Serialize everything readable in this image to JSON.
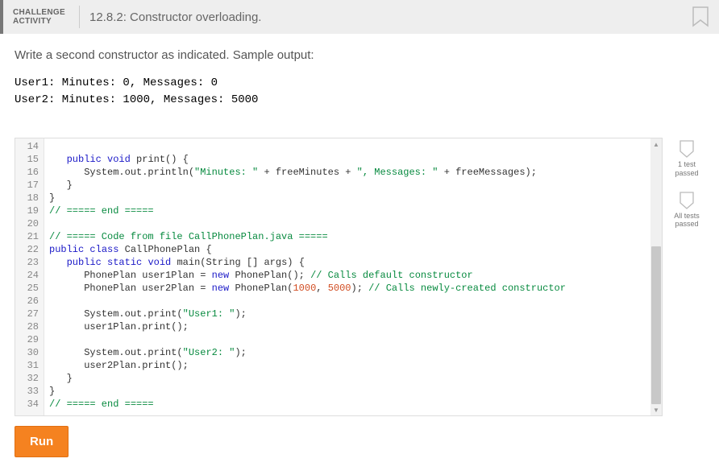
{
  "header": {
    "label_line1": "CHALLENGE",
    "label_line2": "ACTIVITY",
    "title": "12.8.2: Constructor overloading."
  },
  "instructions": "Write a second constructor as indicated. Sample output:",
  "sample_output": "User1: Minutes: 0, Messages: 0\nUser2: Minutes: 1000, Messages: 5000",
  "editor": {
    "first_line_no": 14,
    "lines": [
      {
        "n": 14,
        "tokens": []
      },
      {
        "n": 15,
        "tokens": [
          [
            "pl",
            "   "
          ],
          [
            "kw",
            "public"
          ],
          [
            "pl",
            " "
          ],
          [
            "kw",
            "void"
          ],
          [
            "pl",
            " print() {"
          ]
        ]
      },
      {
        "n": 16,
        "tokens": [
          [
            "pl",
            "      System.out.println("
          ],
          [
            "str",
            "\"Minutes: \""
          ],
          [
            "pl",
            " + freeMinutes + "
          ],
          [
            "str",
            "\", Messages: \""
          ],
          [
            "pl",
            " + freeMessages);"
          ]
        ]
      },
      {
        "n": 17,
        "tokens": [
          [
            "pl",
            "   }"
          ]
        ]
      },
      {
        "n": 18,
        "tokens": [
          [
            "pl",
            "}"
          ]
        ]
      },
      {
        "n": 19,
        "tokens": [
          [
            "cm",
            "// ===== end ====="
          ]
        ]
      },
      {
        "n": 20,
        "tokens": []
      },
      {
        "n": 21,
        "tokens": [
          [
            "cm",
            "// ===== Code from file CallPhonePlan.java ====="
          ]
        ]
      },
      {
        "n": 22,
        "tokens": [
          [
            "kw",
            "public"
          ],
          [
            "pl",
            " "
          ],
          [
            "kw",
            "class"
          ],
          [
            "pl",
            " CallPhonePlan {"
          ]
        ]
      },
      {
        "n": 23,
        "tokens": [
          [
            "pl",
            "   "
          ],
          [
            "kw",
            "public"
          ],
          [
            "pl",
            " "
          ],
          [
            "kw",
            "static"
          ],
          [
            "pl",
            " "
          ],
          [
            "kw",
            "void"
          ],
          [
            "pl",
            " main(String [] args) {"
          ]
        ]
      },
      {
        "n": 24,
        "tokens": [
          [
            "pl",
            "      PhonePlan user1Plan = "
          ],
          [
            "kw",
            "new"
          ],
          [
            "pl",
            " PhonePlan(); "
          ],
          [
            "cm",
            "// Calls default constructor"
          ]
        ]
      },
      {
        "n": 25,
        "tokens": [
          [
            "pl",
            "      PhonePlan user2Plan = "
          ],
          [
            "kw",
            "new"
          ],
          [
            "pl",
            " PhonePlan("
          ],
          [
            "num",
            "1000"
          ],
          [
            "pl",
            ", "
          ],
          [
            "num",
            "5000"
          ],
          [
            "pl",
            "); "
          ],
          [
            "cm",
            "// Calls newly-created constructor"
          ]
        ]
      },
      {
        "n": 26,
        "tokens": []
      },
      {
        "n": 27,
        "tokens": [
          [
            "pl",
            "      System.out.print("
          ],
          [
            "str",
            "\"User1: \""
          ],
          [
            "pl",
            ");"
          ]
        ]
      },
      {
        "n": 28,
        "tokens": [
          [
            "pl",
            "      user1Plan.print();"
          ]
        ]
      },
      {
        "n": 29,
        "tokens": []
      },
      {
        "n": 30,
        "tokens": [
          [
            "pl",
            "      System.out.print("
          ],
          [
            "str",
            "\"User2: \""
          ],
          [
            "pl",
            ");"
          ]
        ]
      },
      {
        "n": 31,
        "tokens": [
          [
            "pl",
            "      user2Plan.print();"
          ]
        ]
      },
      {
        "n": 32,
        "tokens": [
          [
            "pl",
            "   }"
          ]
        ]
      },
      {
        "n": 33,
        "tokens": [
          [
            "pl",
            "}"
          ]
        ]
      },
      {
        "n": 34,
        "tokens": [
          [
            "cm",
            "// ===== end ====="
          ]
        ]
      }
    ]
  },
  "badges": {
    "one_test": "1 test\npassed",
    "all_tests": "All tests\npassed"
  },
  "run_label": "Run"
}
